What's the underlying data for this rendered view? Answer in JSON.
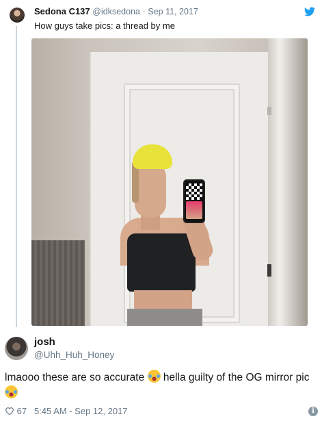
{
  "first_tweet": {
    "name": "Sedona C137",
    "handle": "@idksedona",
    "separator": "·",
    "date": "Sep 11, 2017",
    "text": "How guys take pics: a thread by me",
    "platform_icon": "twitter-bird-icon",
    "accent_color": "#1da1f2"
  },
  "reply_tweet": {
    "name": "josh",
    "handle": "@Uhh_Huh_Honey",
    "text_part1": "lmaooo these are so accurate",
    "text_part2": "hella guilty of the OG mirror pic",
    "emoji": "face-with-tears-of-joy-icon",
    "likes": "67",
    "timestamp": "5:45 AM - Sep 12, 2017",
    "info_glyph": "i"
  }
}
